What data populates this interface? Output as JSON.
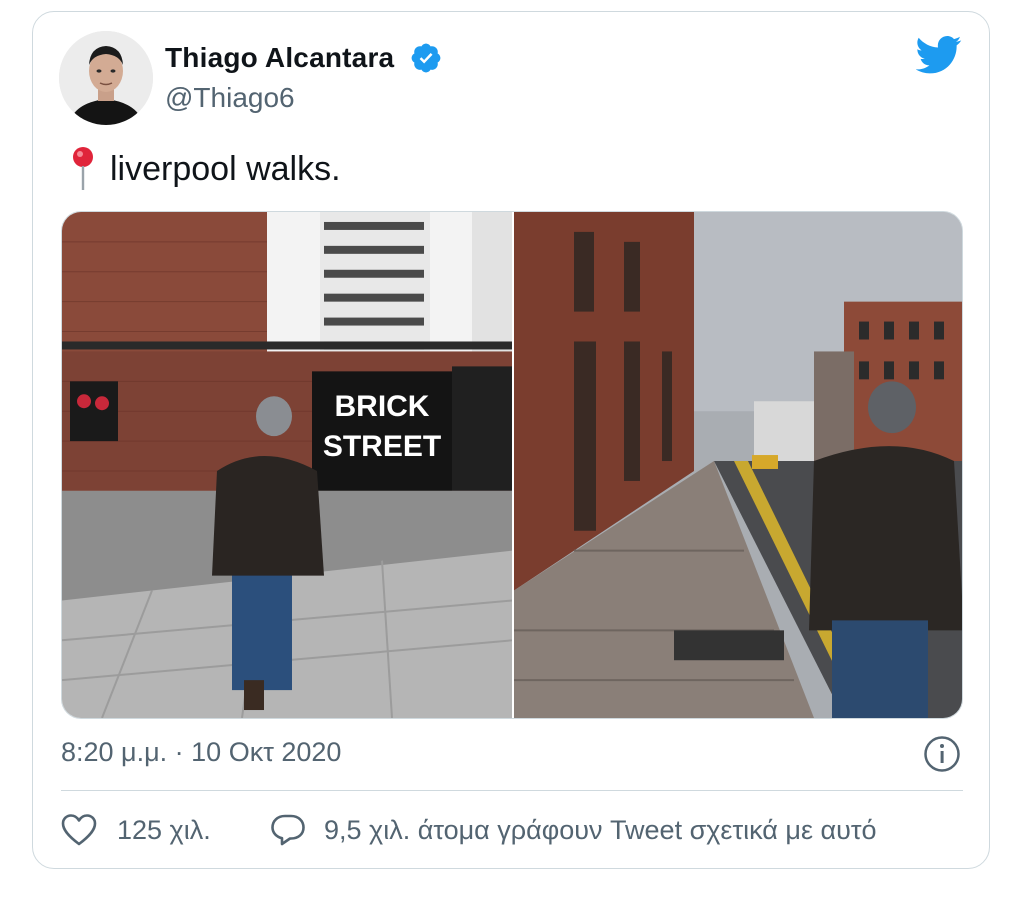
{
  "author": {
    "name": "Thiago Alcantara",
    "handle": "@Thiago6",
    "verified": true
  },
  "tweet": {
    "text": "liverpool walks.",
    "emoji": "round-pushpin-icon"
  },
  "media": {
    "photos": [
      {
        "description": "man-walking-brick-street-photo",
        "sign_line1": "BRICK",
        "sign_line2": "STREET"
      },
      {
        "description": "man-walking-wet-sidewalk-photo"
      }
    ]
  },
  "meta": {
    "timestamp": "8:20 μ.μ. · 10 Οκτ 2020"
  },
  "actions": {
    "likes": "125 χιλ.",
    "talking": "9,5 χιλ. άτομα γράφουν Tweet σχετικά με αυτό"
  },
  "colors": {
    "twitter_blue": "#1d9bf0",
    "text_primary": "#0f1419",
    "text_secondary": "#536471",
    "border": "#cfd9de"
  }
}
